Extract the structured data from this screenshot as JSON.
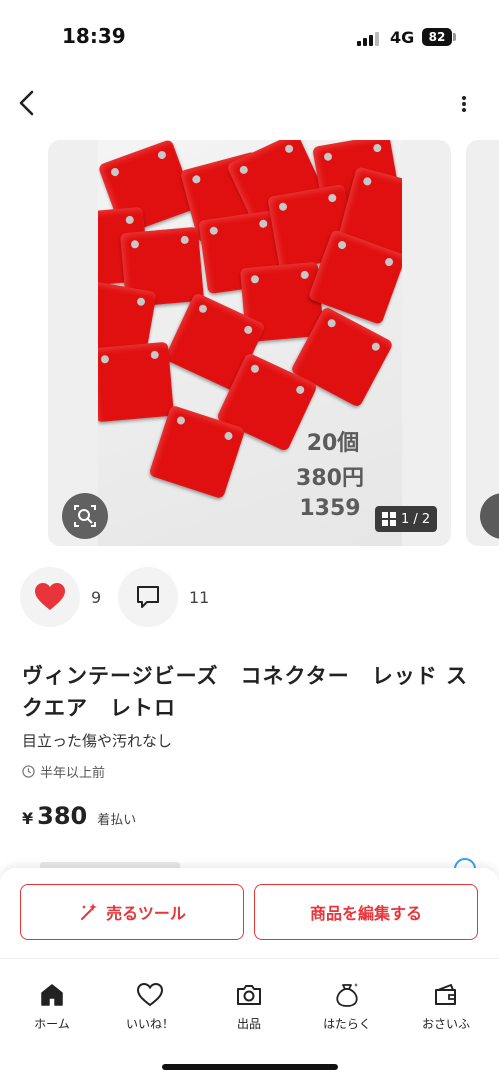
{
  "status_bar": {
    "time": "18:39",
    "network": "4G",
    "battery": "82"
  },
  "header": {
    "back_icon": "chevron-left-icon",
    "more_icon": "more-vertical-icon"
  },
  "gallery": {
    "photo_text": [
      "20個",
      "380円",
      "1359"
    ],
    "counter": "1 / 2",
    "lens_icon": "image-search-icon",
    "counter_icon": "grid-icon"
  },
  "social": {
    "likes": "9",
    "comments": "11",
    "like_color": "#e8353a"
  },
  "product": {
    "title": "ヴィンテージビーズ　コネクター　レッド スクエア　レトロ",
    "subtitle": "目立った傷や汚れなし",
    "posted_time": "半年以上前",
    "price_currency": "¥",
    "price": "380",
    "shipping": "着払い"
  },
  "actions": {
    "sell_tools_label": "売るツール",
    "edit_item_label": "商品を編集する",
    "accent_color": "#e8353a"
  },
  "tabs": [
    {
      "label": "ホーム",
      "icon": "home-icon"
    },
    {
      "label": "いいね！",
      "icon": "heart-icon"
    },
    {
      "label": "出品",
      "icon": "camera-icon"
    },
    {
      "label": "はたらく",
      "icon": "money-bag-icon"
    },
    {
      "label": "おさいふ",
      "icon": "wallet-icon"
    }
  ]
}
